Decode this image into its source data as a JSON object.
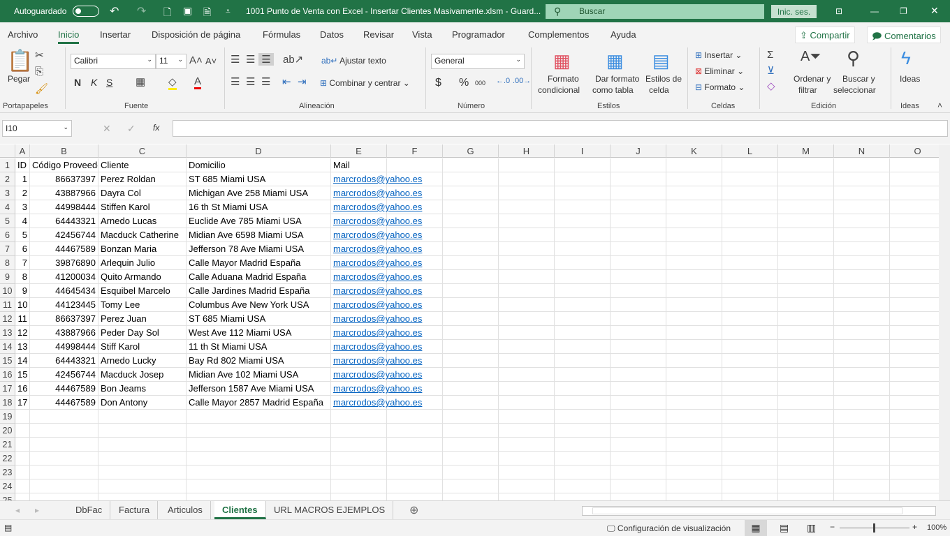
{
  "titlebar": {
    "autosave": "Autoguardado",
    "title": "1001 Punto de Venta con Excel - Insertar Clientes Masivamente.xlsm  -  Guard...",
    "search": "Buscar",
    "signin": "Inic. ses."
  },
  "tabs": [
    "Archivo",
    "Inicio",
    "Insertar",
    "Disposición de página",
    "Fórmulas",
    "Datos",
    "Revisar",
    "Vista",
    "Programador",
    "Complementos",
    "Ayuda"
  ],
  "share": "Compartir",
  "comments": "Comentarios",
  "ribbon": {
    "paste": "Pegar",
    "clipboard": "Portapapeles",
    "font_name": "Calibri",
    "font_size": "11",
    "bold": "N",
    "italic": "K",
    "underline": "S",
    "font_group": "Fuente",
    "wrap": "Ajustar texto",
    "merge": "Combinar y centrar",
    "align_group": "Alineación",
    "number_format": "General",
    "currency": "$",
    "percent": "%",
    "thousands": "000",
    "number_group": "Número",
    "cond_format_1": "Formato",
    "cond_format_2": "condicional",
    "table_format_1": "Dar formato",
    "table_format_2": "como tabla",
    "cell_styles_1": "Estilos de",
    "cell_styles_2": "celda",
    "styles_group": "Estilos",
    "insert": "Insertar",
    "delete": "Eliminar",
    "format": "Formato",
    "cells_group": "Celdas",
    "sort_1": "Ordenar y",
    "sort_2": "filtrar",
    "find_1": "Buscar y",
    "find_2": "seleccionar",
    "edit_group": "Edición",
    "ideas": "Ideas",
    "ideas_group": "Ideas"
  },
  "formula_bar": {
    "name_box": "I10",
    "formula": ""
  },
  "columns": [
    "A",
    "B",
    "C",
    "D",
    "E",
    "F",
    "G",
    "H",
    "I",
    "J",
    "K",
    "L",
    "M",
    "N",
    "O"
  ],
  "table": {
    "headers": [
      "ID",
      "Código  Proveedor",
      "Cliente",
      "Domicilio",
      "Mail"
    ],
    "rows": [
      [
        "1",
        "86637397",
        "Perez Roldan",
        "ST 685 Miami USA",
        "marcrodos@yahoo.es"
      ],
      [
        "2",
        "43887966",
        "Dayra Col",
        "Michigan Ave 258 Miami USA",
        "marcrodos@yahoo.es"
      ],
      [
        "3",
        "44998444",
        "Stiffen Karol",
        "16 th St Miami USA",
        "marcrodos@yahoo.es"
      ],
      [
        "4",
        "64443321",
        "Arnedo Lucas",
        "Euclide Ave 785 Miami USA",
        "marcrodos@yahoo.es"
      ],
      [
        "5",
        "42456744",
        "Macduck Catherine",
        "Midian Ave 6598 Miami USA",
        "marcrodos@yahoo.es"
      ],
      [
        "6",
        "44467589",
        "Bonzan Maria",
        "Jefferson 78 Ave Miami USA",
        "marcrodos@yahoo.es"
      ],
      [
        "7",
        "39876890",
        "Arlequin Julio",
        "Calle Mayor  Madrid España",
        "marcrodos@yahoo.es"
      ],
      [
        "8",
        "41200034",
        "Quito Armando",
        "Calle Aduana  Madrid España",
        "marcrodos@yahoo.es"
      ],
      [
        "9",
        "44645434",
        "Esquibel Marcelo",
        "Calle Jardines Madrid España",
        "marcrodos@yahoo.es"
      ],
      [
        "10",
        "44123445",
        "Tomy Lee",
        "Columbus Ave New York USA",
        "marcrodos@yahoo.es"
      ],
      [
        "11",
        "86637397",
        "Perez Juan",
        "ST 685 Miami USA",
        "marcrodos@yahoo.es"
      ],
      [
        "12",
        "43887966",
        "Peder Day Sol",
        "West Ave 112 Miami USA",
        "marcrodos@yahoo.es"
      ],
      [
        "13",
        "44998444",
        "Stiff Karol",
        "11 th St Miami USA",
        "marcrodos@yahoo.es"
      ],
      [
        "14",
        "64443321",
        "Arnedo Lucky",
        "Bay Rd 802 Miami USA",
        "marcrodos@yahoo.es"
      ],
      [
        "15",
        "42456744",
        "Macduck Josep",
        "Midian Ave 102 Miami USA",
        "marcrodos@yahoo.es"
      ],
      [
        "16",
        "44467589",
        "Bon Jeams",
        "Jefferson 1587 Ave Miami USA",
        "marcrodos@yahoo.es"
      ],
      [
        "17",
        "44467589",
        "Don Antony",
        "Calle Mayor 2857 Madrid España",
        "marcrodos@yahoo.es"
      ]
    ]
  },
  "sheets": [
    "DbFac",
    "Factura",
    "Articulos",
    "Clientes",
    "URL MACROS EJEMPLOS"
  ],
  "active_sheet": "Clientes",
  "status": {
    "display_settings": "Configuración de visualización",
    "zoom": "100%"
  },
  "colors": {
    "brand": "#217346",
    "link": "#0563c1"
  }
}
